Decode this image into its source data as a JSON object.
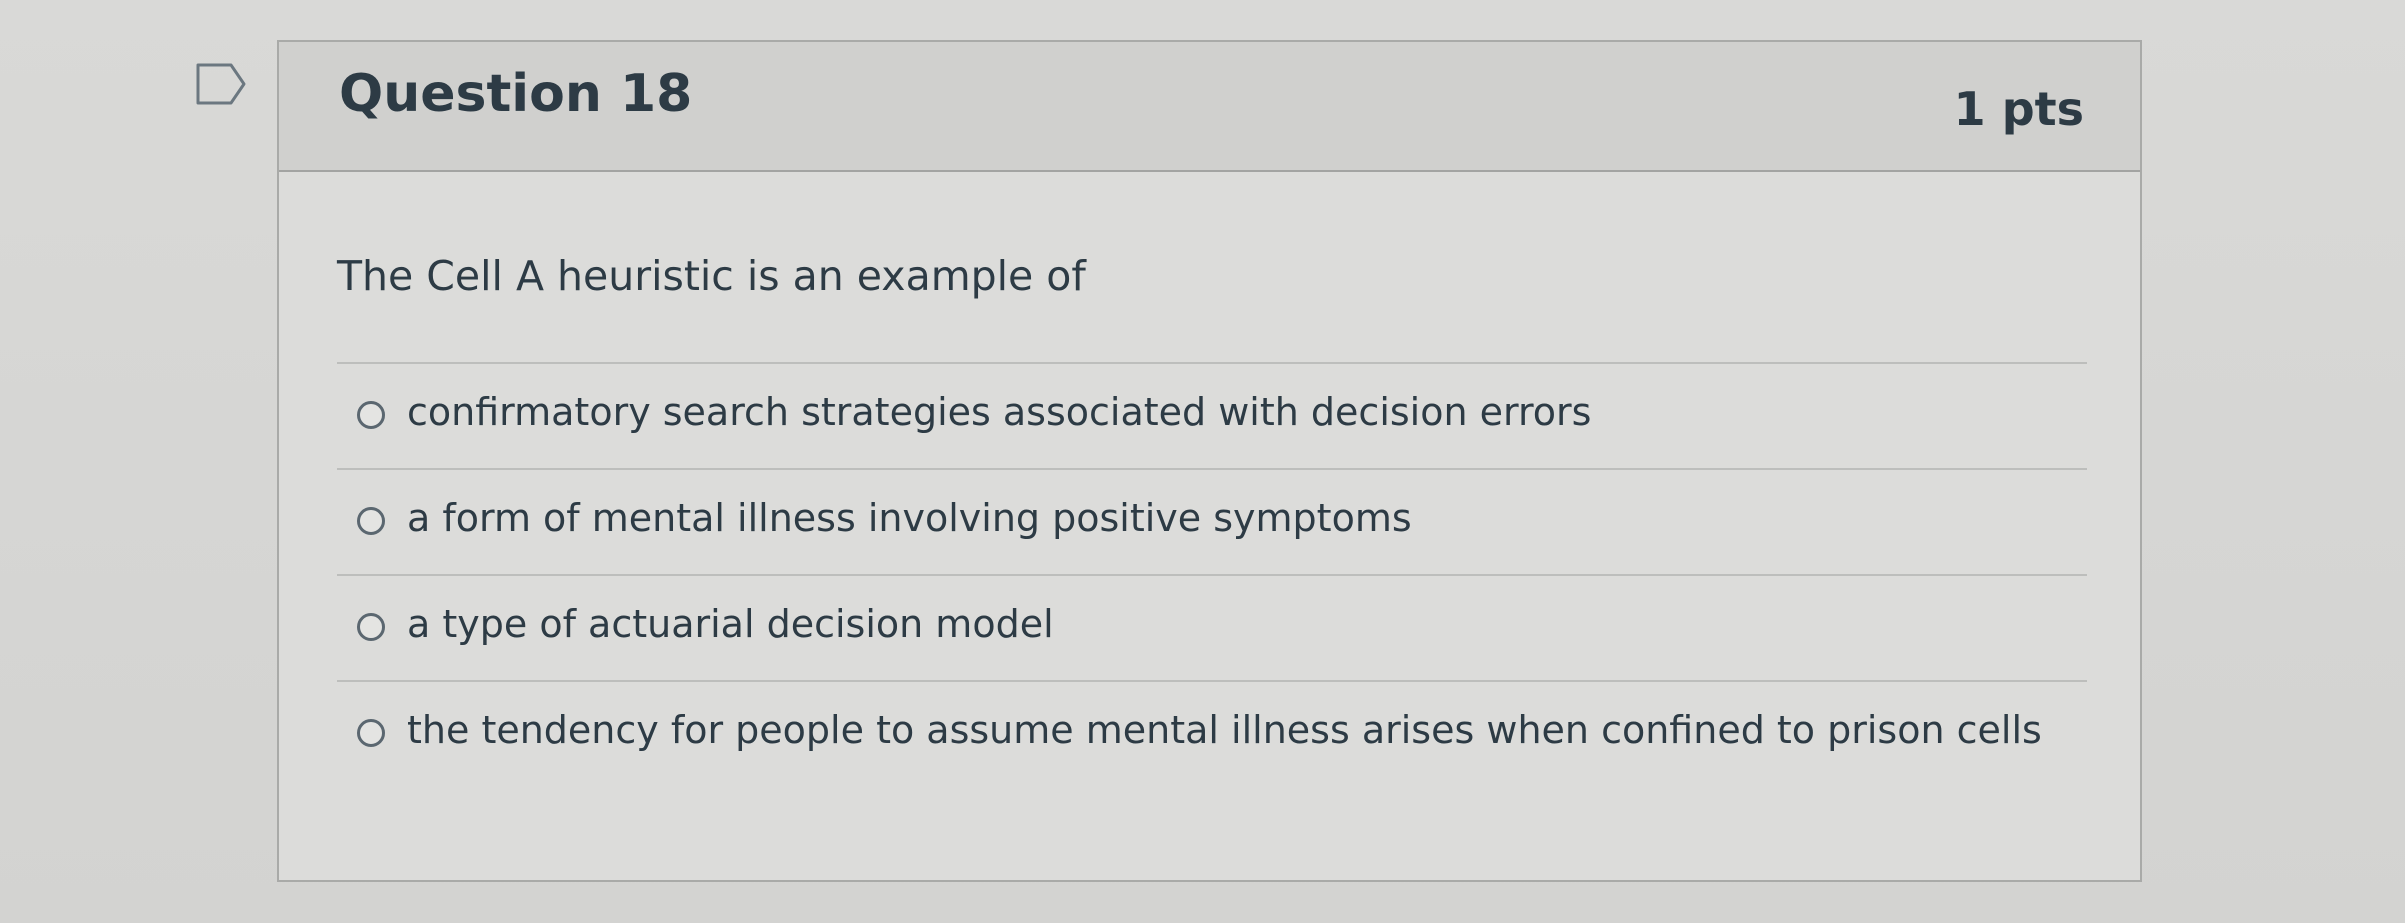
{
  "question": {
    "title": "Question 18",
    "points": "1 pts",
    "text": "The Cell A heuristic is an example of",
    "flag_icon": "flag-outline-icon"
  },
  "answers": [
    {
      "label": "confirmatory search strategies associated with decision errors",
      "selected": false
    },
    {
      "label": "a form of mental illness involving positive symptoms",
      "selected": false
    },
    {
      "label": "a type of actuarial decision model",
      "selected": false
    },
    {
      "label": "the tendency for people to assume mental illness arises when confined to prison cells",
      "selected": false
    }
  ],
  "colors": {
    "text": "#2d3b45",
    "header_bg": "#d0d0ce",
    "border": "#a9aaa8"
  }
}
